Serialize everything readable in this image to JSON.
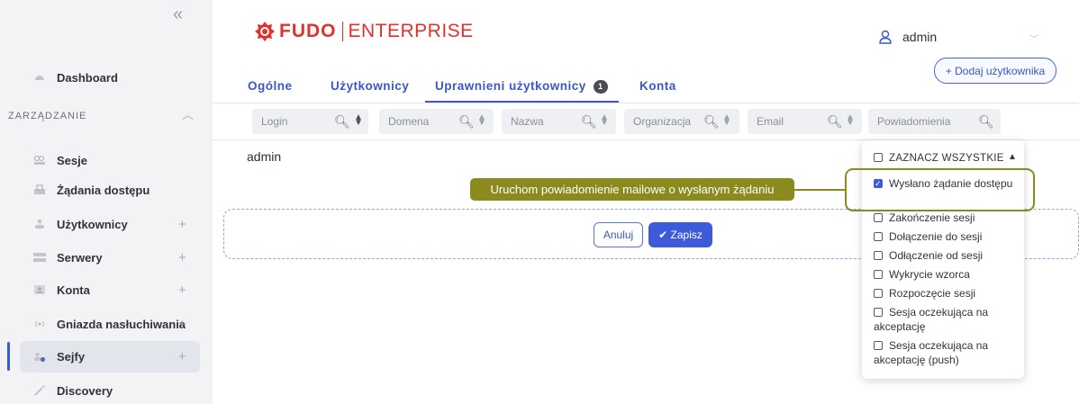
{
  "sidebar": {
    "collapse_icon": "«",
    "items": [
      {
        "label": "Dashboard",
        "icon": "dashboard-icon"
      },
      {
        "label": "Sesje",
        "icon": "sessions-icon"
      },
      {
        "label": "Żądania dostępu",
        "icon": "access-requests-icon"
      },
      {
        "label": "Użytkownicy",
        "icon": "users-icon",
        "expandable": true
      },
      {
        "label": "Serwery",
        "icon": "servers-icon",
        "expandable": true
      },
      {
        "label": "Konta",
        "icon": "accounts-icon",
        "expandable": true
      },
      {
        "label": "Gniazda nasłuchiwania",
        "icon": "listeners-icon",
        "expandable": true
      },
      {
        "label": "Sejfy",
        "icon": "safes-icon",
        "expandable": true,
        "active": true
      },
      {
        "label": "Discovery",
        "icon": "discovery-icon"
      }
    ],
    "section_label": "ZARZĄDZANIE",
    "plus": "+"
  },
  "header": {
    "logo_fudo": "FUDO",
    "logo_enterprise": "ENTERPRISE",
    "user_name": "admin",
    "add_user_label": "+ Dodaj użytkownika"
  },
  "tabs": [
    {
      "label": "Ogólne"
    },
    {
      "label": "Użytkownicy"
    },
    {
      "label": "Uprawnieni użytkownicy",
      "badge": "1",
      "active": true
    },
    {
      "label": "Konta"
    }
  ],
  "filters": [
    {
      "placeholder": "Login"
    },
    {
      "placeholder": "Domena"
    },
    {
      "placeholder": "Nazwa"
    },
    {
      "placeholder": "Organizacja"
    },
    {
      "placeholder": "Email"
    },
    {
      "placeholder": "Powiadomienia"
    }
  ],
  "rows": [
    {
      "login": "admin"
    }
  ],
  "actions": {
    "cancel_label": "Anuluj",
    "save_label": "✔ Zapisz"
  },
  "tooltip": "Uruchom powiadomienie mailowe o wysłanym żądaniu",
  "dropdown": {
    "select_all": "ZAZNACZ WSZYSTKIE",
    "options": [
      {
        "label": "Wysłano żądanie dostępu",
        "checked": true
      },
      {
        "label": "Zakończenie sesji",
        "checked": false
      },
      {
        "label": "Dołączenie do sesji",
        "checked": false
      },
      {
        "label": "Odłączenie od sesji",
        "checked": false
      },
      {
        "label": "Wykrycie wzorca",
        "checked": false
      },
      {
        "label": "Rozpoczęcie sesji",
        "checked": false
      },
      {
        "label": "Sesja oczekująca na akceptację",
        "checked": false
      },
      {
        "label": "Sesja oczekująca na akceptację (push)",
        "checked": false
      }
    ]
  },
  "colors": {
    "accent": "#3b57c9",
    "brand": "#e0322a",
    "tooltip": "#8a8a1e"
  }
}
